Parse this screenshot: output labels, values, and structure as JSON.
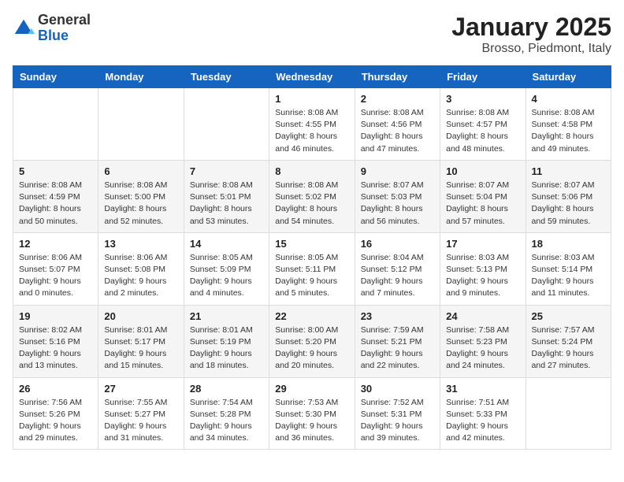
{
  "header": {
    "logo_general": "General",
    "logo_blue": "Blue",
    "month_title": "January 2025",
    "location": "Brosso, Piedmont, Italy"
  },
  "weekdays": [
    "Sunday",
    "Monday",
    "Tuesday",
    "Wednesday",
    "Thursday",
    "Friday",
    "Saturday"
  ],
  "weeks": [
    [
      {
        "day": "",
        "info": ""
      },
      {
        "day": "",
        "info": ""
      },
      {
        "day": "",
        "info": ""
      },
      {
        "day": "1",
        "info": "Sunrise: 8:08 AM\nSunset: 4:55 PM\nDaylight: 8 hours\nand 46 minutes."
      },
      {
        "day": "2",
        "info": "Sunrise: 8:08 AM\nSunset: 4:56 PM\nDaylight: 8 hours\nand 47 minutes."
      },
      {
        "day": "3",
        "info": "Sunrise: 8:08 AM\nSunset: 4:57 PM\nDaylight: 8 hours\nand 48 minutes."
      },
      {
        "day": "4",
        "info": "Sunrise: 8:08 AM\nSunset: 4:58 PM\nDaylight: 8 hours\nand 49 minutes."
      }
    ],
    [
      {
        "day": "5",
        "info": "Sunrise: 8:08 AM\nSunset: 4:59 PM\nDaylight: 8 hours\nand 50 minutes."
      },
      {
        "day": "6",
        "info": "Sunrise: 8:08 AM\nSunset: 5:00 PM\nDaylight: 8 hours\nand 52 minutes."
      },
      {
        "day": "7",
        "info": "Sunrise: 8:08 AM\nSunset: 5:01 PM\nDaylight: 8 hours\nand 53 minutes."
      },
      {
        "day": "8",
        "info": "Sunrise: 8:08 AM\nSunset: 5:02 PM\nDaylight: 8 hours\nand 54 minutes."
      },
      {
        "day": "9",
        "info": "Sunrise: 8:07 AM\nSunset: 5:03 PM\nDaylight: 8 hours\nand 56 minutes."
      },
      {
        "day": "10",
        "info": "Sunrise: 8:07 AM\nSunset: 5:04 PM\nDaylight: 8 hours\nand 57 minutes."
      },
      {
        "day": "11",
        "info": "Sunrise: 8:07 AM\nSunset: 5:06 PM\nDaylight: 8 hours\nand 59 minutes."
      }
    ],
    [
      {
        "day": "12",
        "info": "Sunrise: 8:06 AM\nSunset: 5:07 PM\nDaylight: 9 hours\nand 0 minutes."
      },
      {
        "day": "13",
        "info": "Sunrise: 8:06 AM\nSunset: 5:08 PM\nDaylight: 9 hours\nand 2 minutes."
      },
      {
        "day": "14",
        "info": "Sunrise: 8:05 AM\nSunset: 5:09 PM\nDaylight: 9 hours\nand 4 minutes."
      },
      {
        "day": "15",
        "info": "Sunrise: 8:05 AM\nSunset: 5:11 PM\nDaylight: 9 hours\nand 5 minutes."
      },
      {
        "day": "16",
        "info": "Sunrise: 8:04 AM\nSunset: 5:12 PM\nDaylight: 9 hours\nand 7 minutes."
      },
      {
        "day": "17",
        "info": "Sunrise: 8:03 AM\nSunset: 5:13 PM\nDaylight: 9 hours\nand 9 minutes."
      },
      {
        "day": "18",
        "info": "Sunrise: 8:03 AM\nSunset: 5:14 PM\nDaylight: 9 hours\nand 11 minutes."
      }
    ],
    [
      {
        "day": "19",
        "info": "Sunrise: 8:02 AM\nSunset: 5:16 PM\nDaylight: 9 hours\nand 13 minutes."
      },
      {
        "day": "20",
        "info": "Sunrise: 8:01 AM\nSunset: 5:17 PM\nDaylight: 9 hours\nand 15 minutes."
      },
      {
        "day": "21",
        "info": "Sunrise: 8:01 AM\nSunset: 5:19 PM\nDaylight: 9 hours\nand 18 minutes."
      },
      {
        "day": "22",
        "info": "Sunrise: 8:00 AM\nSunset: 5:20 PM\nDaylight: 9 hours\nand 20 minutes."
      },
      {
        "day": "23",
        "info": "Sunrise: 7:59 AM\nSunset: 5:21 PM\nDaylight: 9 hours\nand 22 minutes."
      },
      {
        "day": "24",
        "info": "Sunrise: 7:58 AM\nSunset: 5:23 PM\nDaylight: 9 hours\nand 24 minutes."
      },
      {
        "day": "25",
        "info": "Sunrise: 7:57 AM\nSunset: 5:24 PM\nDaylight: 9 hours\nand 27 minutes."
      }
    ],
    [
      {
        "day": "26",
        "info": "Sunrise: 7:56 AM\nSunset: 5:26 PM\nDaylight: 9 hours\nand 29 minutes."
      },
      {
        "day": "27",
        "info": "Sunrise: 7:55 AM\nSunset: 5:27 PM\nDaylight: 9 hours\nand 31 minutes."
      },
      {
        "day": "28",
        "info": "Sunrise: 7:54 AM\nSunset: 5:28 PM\nDaylight: 9 hours\nand 34 minutes."
      },
      {
        "day": "29",
        "info": "Sunrise: 7:53 AM\nSunset: 5:30 PM\nDaylight: 9 hours\nand 36 minutes."
      },
      {
        "day": "30",
        "info": "Sunrise: 7:52 AM\nSunset: 5:31 PM\nDaylight: 9 hours\nand 39 minutes."
      },
      {
        "day": "31",
        "info": "Sunrise: 7:51 AM\nSunset: 5:33 PM\nDaylight: 9 hours\nand 42 minutes."
      },
      {
        "day": "",
        "info": ""
      }
    ]
  ]
}
